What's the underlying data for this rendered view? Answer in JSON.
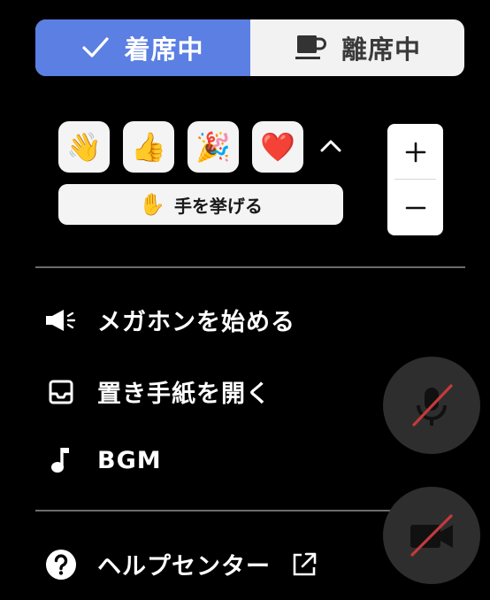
{
  "status": {
    "present_label": "着席中",
    "away_label": "離席中",
    "active": "present",
    "present_color": "#5b7fe2"
  },
  "reactions": {
    "emojis": [
      "👋",
      "👍",
      "🎉",
      "❤️"
    ],
    "raise_hand_icon": "✋",
    "raise_hand_label": "手を挙げる"
  },
  "zoom": {
    "plus": "+",
    "minus": "−"
  },
  "menu": {
    "megaphone_label": "メガホンを始める",
    "letter_label": "置き手紙を開く",
    "bgm_label": "BGM",
    "help_label": "ヘルプセンター"
  },
  "media": {
    "mic": "muted",
    "camera": "off",
    "off_slash_color": "#c43a3a"
  }
}
